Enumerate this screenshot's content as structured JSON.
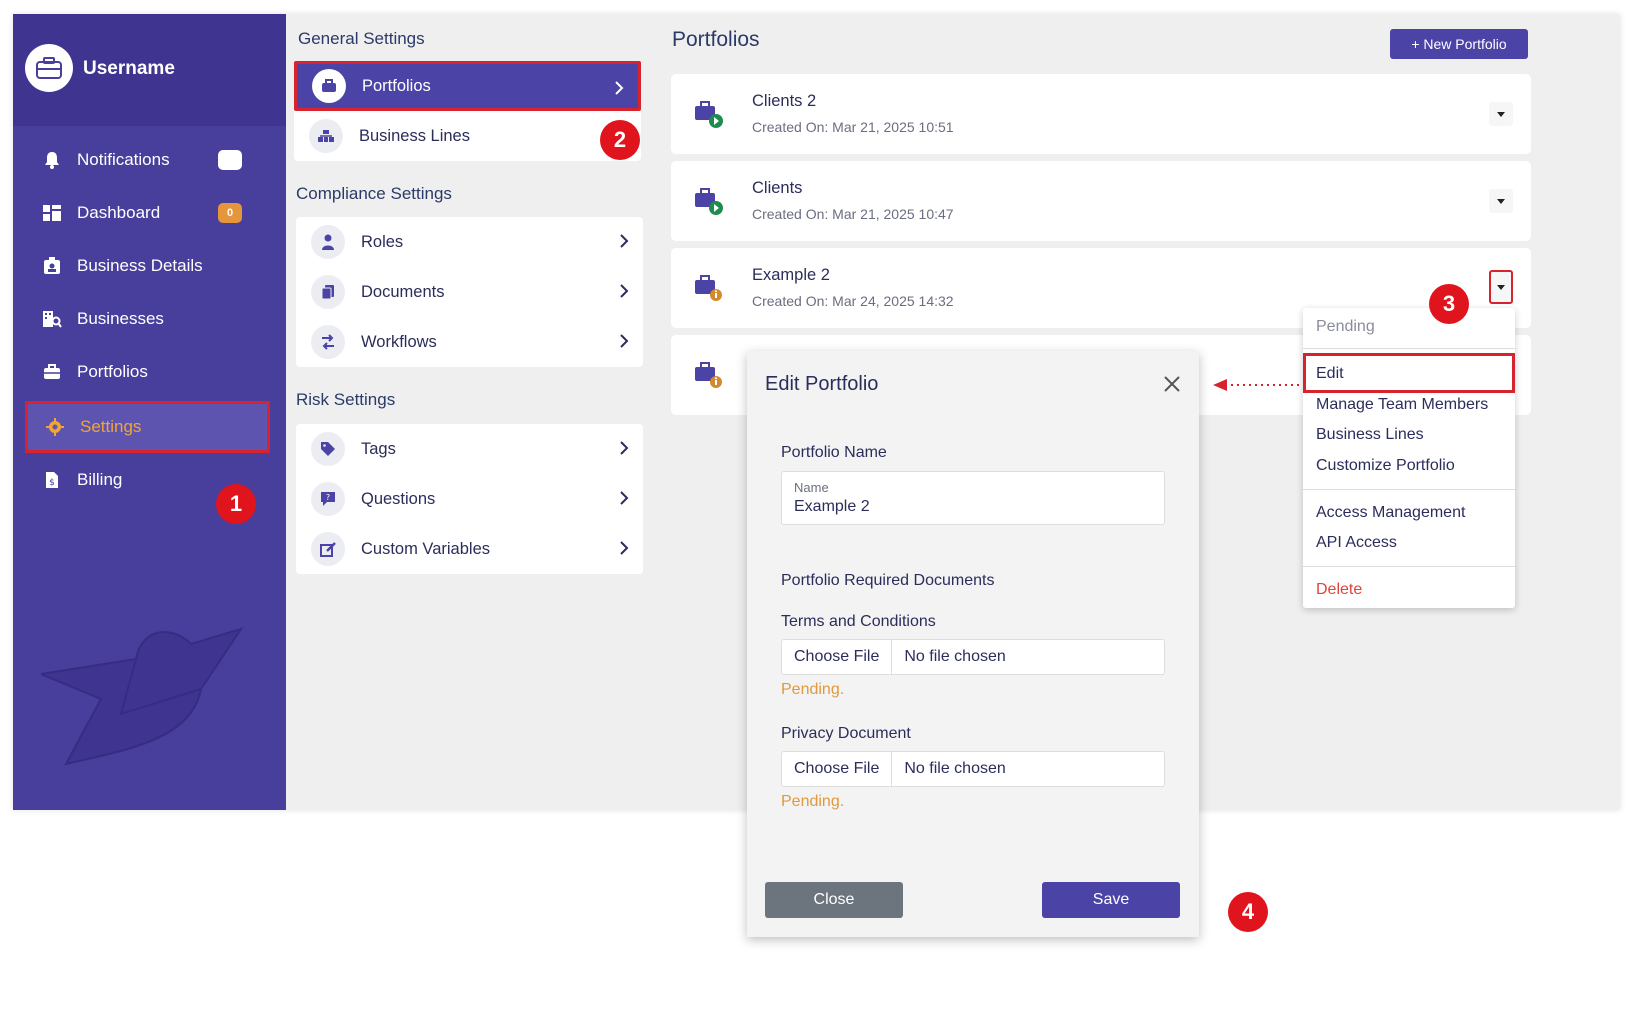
{
  "sidebar": {
    "username": "Username",
    "items": [
      {
        "label": "Notifications",
        "icon": "bell-icon",
        "badge": ""
      },
      {
        "label": "Dashboard",
        "icon": "dashboard-icon",
        "badge": "0"
      },
      {
        "label": "Business Details",
        "icon": "id-card-icon"
      },
      {
        "label": "Businesses",
        "icon": "building-search-icon"
      },
      {
        "label": "Portfolios",
        "icon": "briefcase-icon"
      },
      {
        "label": "Settings",
        "icon": "gear-icon"
      },
      {
        "label": "Billing",
        "icon": "invoice-icon"
      }
    ]
  },
  "settings": {
    "general_title": "General Settings",
    "general_items": [
      "Portfolios",
      "Business Lines"
    ],
    "compliance_title": "Compliance Settings",
    "compliance_items": [
      "Roles",
      "Documents",
      "Workflows"
    ],
    "risk_title": "Risk Settings",
    "risk_items": [
      "Tags",
      "Questions",
      "Custom Variables"
    ]
  },
  "content": {
    "title": "Portfolios",
    "new_button": "+ New Portfolio",
    "portfolios": [
      {
        "name": "Clients 2",
        "created": "Created On: Mar 21, 2025 10:51",
        "status": "active"
      },
      {
        "name": "Clients",
        "created": "Created On: Mar 21, 2025 10:47",
        "status": "active"
      },
      {
        "name": "Example 2",
        "created": "Created On: Mar 24, 2025 14:32",
        "status": "pending"
      }
    ]
  },
  "menu": {
    "status": "Pending",
    "items": [
      "Edit",
      "Manage Team Members",
      "Business Lines",
      "Customize Portfolio"
    ],
    "items2": [
      "Access Management",
      "API Access"
    ],
    "delete": "Delete"
  },
  "modal": {
    "title": "Edit Portfolio",
    "name_section": "Portfolio Name",
    "name_caption": "Name",
    "name_value": "Example 2",
    "docs_section": "Portfolio Required Documents",
    "doc1_label": "Terms and Conditions",
    "doc2_label": "Privacy Document",
    "choose_file": "Choose File",
    "no_file": "No file chosen",
    "pending": "Pending.",
    "close": "Close",
    "save": "Save"
  },
  "steps": [
    "1",
    "2",
    "3",
    "4"
  ],
  "colors": {
    "sidebar": "#483e9c",
    "accent": "#4b43a6",
    "highlight": "#d6232d",
    "active_text": "#f2a532",
    "pending": "#e09a3c",
    "delete": "#e0443c"
  }
}
